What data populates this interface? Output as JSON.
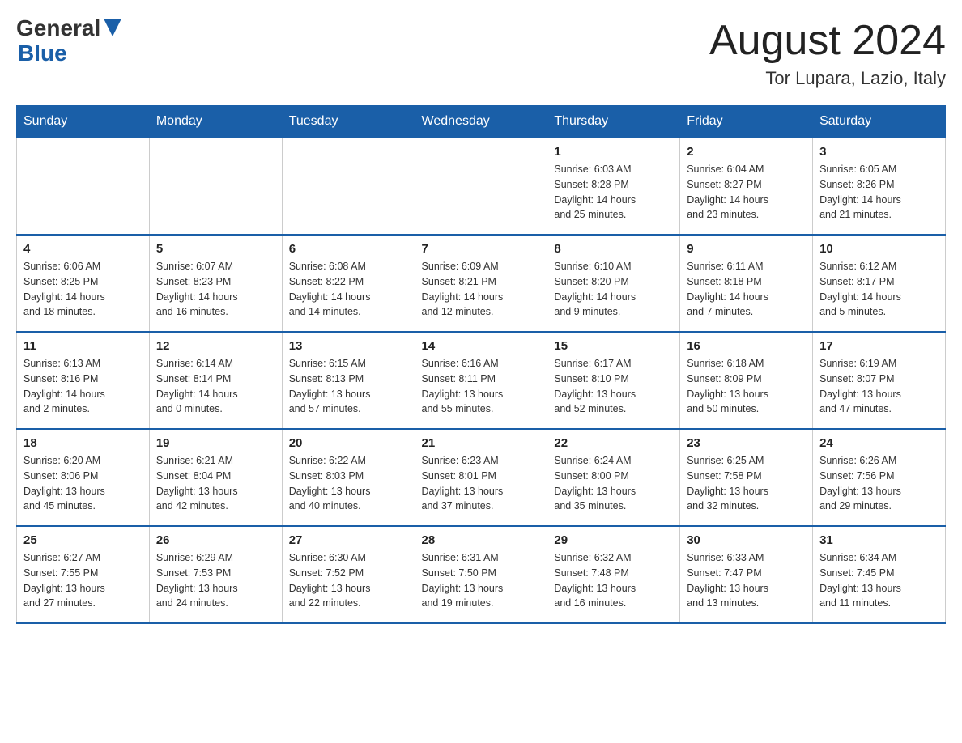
{
  "header": {
    "logo_general": "General",
    "logo_blue": "Blue",
    "month": "August 2024",
    "location": "Tor Lupara, Lazio, Italy"
  },
  "days_of_week": [
    "Sunday",
    "Monday",
    "Tuesday",
    "Wednesday",
    "Thursday",
    "Friday",
    "Saturday"
  ],
  "weeks": [
    [
      {
        "day": "",
        "info": ""
      },
      {
        "day": "",
        "info": ""
      },
      {
        "day": "",
        "info": ""
      },
      {
        "day": "",
        "info": ""
      },
      {
        "day": "1",
        "info": "Sunrise: 6:03 AM\nSunset: 8:28 PM\nDaylight: 14 hours\nand 25 minutes."
      },
      {
        "day": "2",
        "info": "Sunrise: 6:04 AM\nSunset: 8:27 PM\nDaylight: 14 hours\nand 23 minutes."
      },
      {
        "day": "3",
        "info": "Sunrise: 6:05 AM\nSunset: 8:26 PM\nDaylight: 14 hours\nand 21 minutes."
      }
    ],
    [
      {
        "day": "4",
        "info": "Sunrise: 6:06 AM\nSunset: 8:25 PM\nDaylight: 14 hours\nand 18 minutes."
      },
      {
        "day": "5",
        "info": "Sunrise: 6:07 AM\nSunset: 8:23 PM\nDaylight: 14 hours\nand 16 minutes."
      },
      {
        "day": "6",
        "info": "Sunrise: 6:08 AM\nSunset: 8:22 PM\nDaylight: 14 hours\nand 14 minutes."
      },
      {
        "day": "7",
        "info": "Sunrise: 6:09 AM\nSunset: 8:21 PM\nDaylight: 14 hours\nand 12 minutes."
      },
      {
        "day": "8",
        "info": "Sunrise: 6:10 AM\nSunset: 8:20 PM\nDaylight: 14 hours\nand 9 minutes."
      },
      {
        "day": "9",
        "info": "Sunrise: 6:11 AM\nSunset: 8:18 PM\nDaylight: 14 hours\nand 7 minutes."
      },
      {
        "day": "10",
        "info": "Sunrise: 6:12 AM\nSunset: 8:17 PM\nDaylight: 14 hours\nand 5 minutes."
      }
    ],
    [
      {
        "day": "11",
        "info": "Sunrise: 6:13 AM\nSunset: 8:16 PM\nDaylight: 14 hours\nand 2 minutes."
      },
      {
        "day": "12",
        "info": "Sunrise: 6:14 AM\nSunset: 8:14 PM\nDaylight: 14 hours\nand 0 minutes."
      },
      {
        "day": "13",
        "info": "Sunrise: 6:15 AM\nSunset: 8:13 PM\nDaylight: 13 hours\nand 57 minutes."
      },
      {
        "day": "14",
        "info": "Sunrise: 6:16 AM\nSunset: 8:11 PM\nDaylight: 13 hours\nand 55 minutes."
      },
      {
        "day": "15",
        "info": "Sunrise: 6:17 AM\nSunset: 8:10 PM\nDaylight: 13 hours\nand 52 minutes."
      },
      {
        "day": "16",
        "info": "Sunrise: 6:18 AM\nSunset: 8:09 PM\nDaylight: 13 hours\nand 50 minutes."
      },
      {
        "day": "17",
        "info": "Sunrise: 6:19 AM\nSunset: 8:07 PM\nDaylight: 13 hours\nand 47 minutes."
      }
    ],
    [
      {
        "day": "18",
        "info": "Sunrise: 6:20 AM\nSunset: 8:06 PM\nDaylight: 13 hours\nand 45 minutes."
      },
      {
        "day": "19",
        "info": "Sunrise: 6:21 AM\nSunset: 8:04 PM\nDaylight: 13 hours\nand 42 minutes."
      },
      {
        "day": "20",
        "info": "Sunrise: 6:22 AM\nSunset: 8:03 PM\nDaylight: 13 hours\nand 40 minutes."
      },
      {
        "day": "21",
        "info": "Sunrise: 6:23 AM\nSunset: 8:01 PM\nDaylight: 13 hours\nand 37 minutes."
      },
      {
        "day": "22",
        "info": "Sunrise: 6:24 AM\nSunset: 8:00 PM\nDaylight: 13 hours\nand 35 minutes."
      },
      {
        "day": "23",
        "info": "Sunrise: 6:25 AM\nSunset: 7:58 PM\nDaylight: 13 hours\nand 32 minutes."
      },
      {
        "day": "24",
        "info": "Sunrise: 6:26 AM\nSunset: 7:56 PM\nDaylight: 13 hours\nand 29 minutes."
      }
    ],
    [
      {
        "day": "25",
        "info": "Sunrise: 6:27 AM\nSunset: 7:55 PM\nDaylight: 13 hours\nand 27 minutes."
      },
      {
        "day": "26",
        "info": "Sunrise: 6:29 AM\nSunset: 7:53 PM\nDaylight: 13 hours\nand 24 minutes."
      },
      {
        "day": "27",
        "info": "Sunrise: 6:30 AM\nSunset: 7:52 PM\nDaylight: 13 hours\nand 22 minutes."
      },
      {
        "day": "28",
        "info": "Sunrise: 6:31 AM\nSunset: 7:50 PM\nDaylight: 13 hours\nand 19 minutes."
      },
      {
        "day": "29",
        "info": "Sunrise: 6:32 AM\nSunset: 7:48 PM\nDaylight: 13 hours\nand 16 minutes."
      },
      {
        "day": "30",
        "info": "Sunrise: 6:33 AM\nSunset: 7:47 PM\nDaylight: 13 hours\nand 13 minutes."
      },
      {
        "day": "31",
        "info": "Sunrise: 6:34 AM\nSunset: 7:45 PM\nDaylight: 13 hours\nand 11 minutes."
      }
    ]
  ]
}
